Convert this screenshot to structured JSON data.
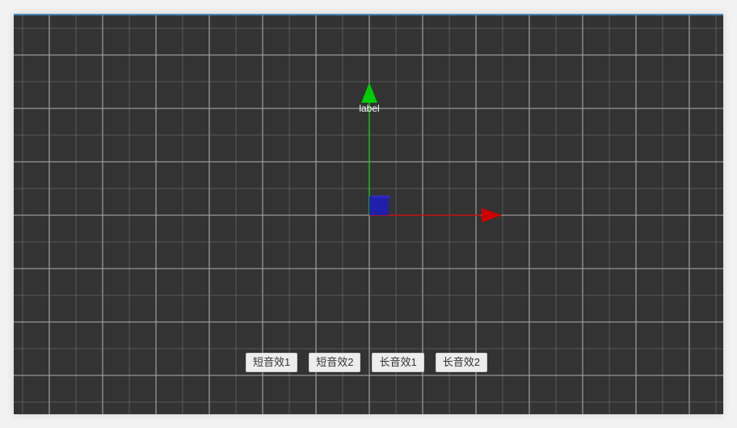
{
  "scene": {
    "axis_label": "label",
    "colors": {
      "background": "#333333",
      "grid": "#8c8c8c",
      "major_grid": "#a8a8a8",
      "x_axis": "#cc0000",
      "y_axis": "#00cc00",
      "z_axis": "#1d1db8",
      "frame_top_line": "#4d87b9"
    }
  },
  "controls": {
    "buttons": [
      {
        "label": "短音效1"
      },
      {
        "label": "短音效2"
      },
      {
        "label": "长音效1"
      },
      {
        "label": "长音效2"
      }
    ]
  }
}
